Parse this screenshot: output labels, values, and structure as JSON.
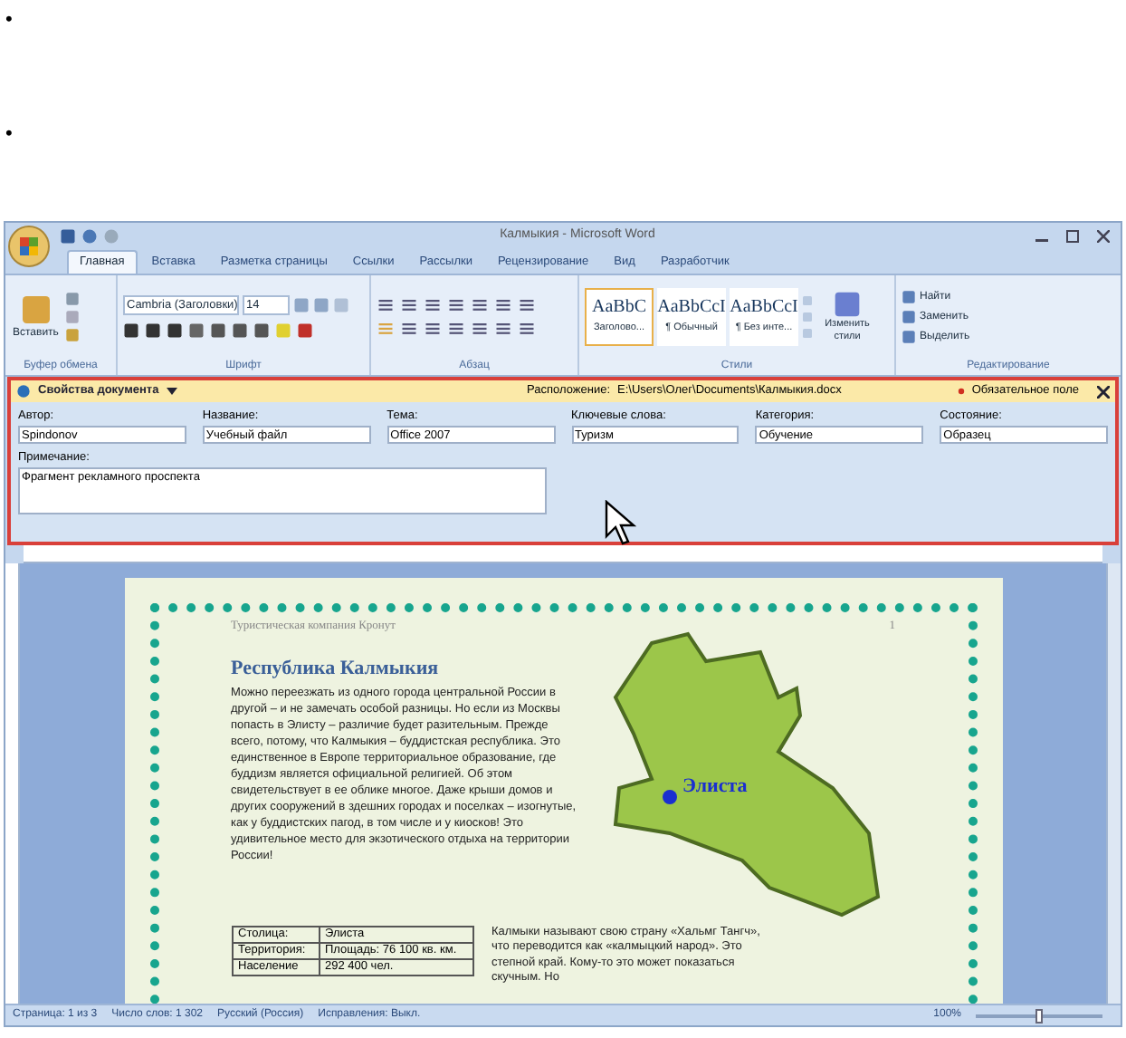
{
  "bullets": [
    {
      "marker": "•"
    },
    {
      "marker": "•"
    }
  ],
  "window": {
    "title": "Калмыкия - Microsoft Word"
  },
  "tabs": [
    {
      "label": "Главная",
      "selected": true
    },
    {
      "label": "Вставка",
      "selected": false
    },
    {
      "label": "Разметка страницы",
      "selected": false
    },
    {
      "label": "Ссылки",
      "selected": false
    },
    {
      "label": "Рассылки",
      "selected": false
    },
    {
      "label": "Рецензирование",
      "selected": false
    },
    {
      "label": "Вид",
      "selected": false
    },
    {
      "label": "Разработчик",
      "selected": false
    }
  ],
  "ribbon": {
    "paste": "Вставить",
    "font": "Cambria (Заголовки)",
    "size": "14",
    "styles": [
      {
        "sample": "AaBbC",
        "name": "Заголово...",
        "selected": true
      },
      {
        "sample": "AaBbCcI",
        "name": "¶ Обычный",
        "selected": false
      },
      {
        "sample": "AaBbCcI",
        "name": "¶ Без инте...",
        "selected": false
      }
    ],
    "change_styles": "Изменить стили",
    "editing": [
      "Найти",
      "Заменить",
      "Выделить"
    ],
    "groups": [
      "Буфер обмена",
      "Шрифт",
      "Абзац",
      "Стили",
      "Редактирование"
    ]
  },
  "doc_panel": {
    "title": "Свойства документа",
    "location_label": "Расположение:",
    "location": "E:\\Users\\Олег\\Documents\\Калмыкия.docx",
    "required": "Обязательное поле",
    "fields": [
      {
        "label": "Автор:",
        "value": "Spindonov"
      },
      {
        "label": "Название:",
        "value": "Учебный файл"
      },
      {
        "label": "Тема:",
        "value": "Office 2007"
      },
      {
        "label": "Ключевые слова:",
        "value": "Туризм"
      },
      {
        "label": "Категория:",
        "value": "Обучение"
      },
      {
        "label": "Состояние:",
        "value": "Образец"
      }
    ],
    "comment": {
      "label": "Примечание:",
      "value": "Фрагмент рекламного проспекта"
    }
  },
  "document": {
    "header": "Туристическая компания Кронут",
    "page_number": "1",
    "heading": "Республика Калмыкия",
    "paragraph": "Можно переезжать из одного города центральной России в другой – и не замечать особой разницы. Но если из Москвы попасть в Элисту – различие будет разительным. Прежде всего, потому, что Калмыкия – буддистская республика. Это единственное в Европе территориальное образование, где буддизм является официальной религией. Об этом свидетельствует в ее облике многое. Даже крыши домов и других сооружений в здешних городах и поселках – изогнутые, как у буддистских пагод, в том числе и у киосков! Это удивительное место для экзотического отдыха на территории России!",
    "map_label": "Элиста",
    "table": [
      [
        "Столица:",
        "Элиста"
      ],
      [
        "Территория:",
        "Площадь: 76 100 кв. км."
      ],
      [
        "Население",
        "292 400 чел."
      ]
    ],
    "side_text": "Калмыки называют свою страну «Хальмг Тангч», что переводится как «калмыцкий народ». Это степной край. Кому-то это может показаться скучным. Но"
  },
  "status_bar": [
    "Страница: 1 из 3",
    "Число слов: 1 302",
    "Русский (Россия)",
    "Исправления: Выкл."
  ],
  "zoom": {
    "label": "100%",
    "level": 0.5
  }
}
